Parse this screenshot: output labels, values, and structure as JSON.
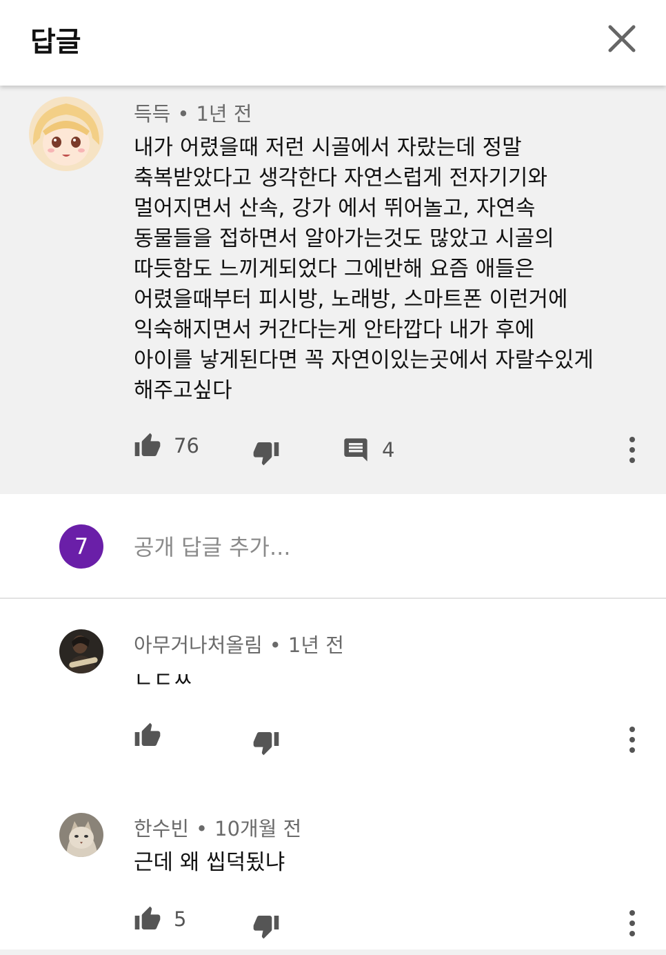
{
  "header": {
    "title": "답글",
    "close_icon": "close-icon"
  },
  "top_comment": {
    "author": "득득",
    "time": "1년 전",
    "lines": [
      "내가 어렸을때 저런 시골에서 자랐는데 정말",
      "축복받았다고 생각한다 자연스럽게 전자기기와",
      "멀어지면서 산속, 강가 에서 뛰어놀고, 자연속",
      "동물들을 접하면서 알아가는것도 많았고 시골의",
      "따듯함도 느끼게되었다 그에반해 요즘 애들은",
      "어렸을때부터 피시방, 노래방, 스마트폰 이런거에",
      "익숙해지면서 커간다는게 안타깝다 내가 후에",
      "아이를 낳게된다면 꼭 자연이있는곳에서 자랄수있게",
      "해주고싶다"
    ],
    "likes": "76",
    "replies": "4"
  },
  "reply_input": {
    "user_initial": "7",
    "placeholder": "공개 답글 추가...",
    "avatar_color": "#6a1fa8"
  },
  "replies": [
    {
      "author": "아무거나처올림",
      "time": "1년 전",
      "text": "ㄴㄷㅆ",
      "likes": ""
    },
    {
      "author": "한수빈",
      "time": "10개월 전",
      "text": "근데 왜 씹덕됬냐",
      "likes": "5"
    }
  ],
  "separator": "•"
}
